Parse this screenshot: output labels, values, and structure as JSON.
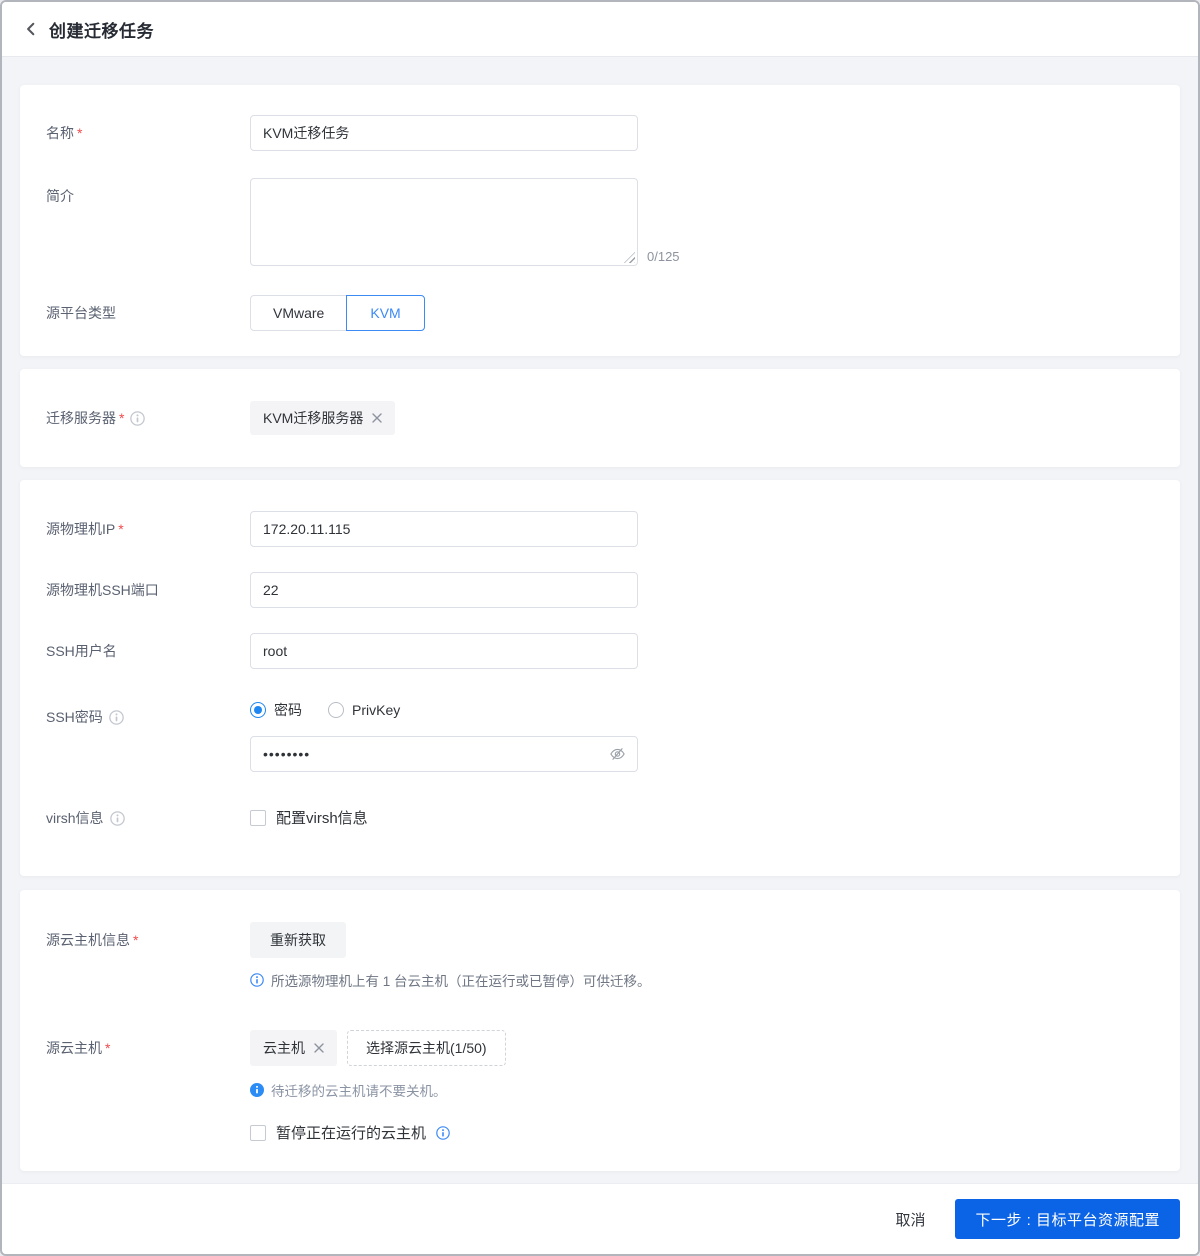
{
  "header": {
    "title": "创建迁移任务"
  },
  "misc": {
    "required_mark": "*"
  },
  "form": {
    "name": {
      "label": "名称",
      "value": "KVM迁移任务"
    },
    "intro": {
      "label": "简介",
      "value": "",
      "counter": "0/125"
    },
    "platform": {
      "label": "源平台类型",
      "options": [
        "VMware",
        "KVM"
      ],
      "selected": "KVM"
    },
    "server": {
      "label": "迁移服务器",
      "tag": "KVM迁移服务器"
    },
    "source_ip": {
      "label": "源物理机IP",
      "value": "172.20.11.115"
    },
    "ssh_port": {
      "label": "源物理机SSH端口",
      "value": "22"
    },
    "ssh_user": {
      "label": "SSH用户名",
      "value": "root"
    },
    "ssh_password": {
      "label": "SSH密码",
      "options": [
        "密码",
        "PrivKey"
      ],
      "selected": "密码",
      "value": "••••••••"
    },
    "virsh": {
      "label": "virsh信息",
      "checkbox_label": "配置virsh信息",
      "checked": false
    },
    "source_vm_info": {
      "label": "源云主机信息",
      "refresh_button": "重新获取",
      "hint": "所选源物理机上有 1 台云主机（正在运行或已暂停）可供迁移。"
    },
    "source_vm": {
      "label": "源云主机",
      "tag": "云主机",
      "select_button": "选择源云主机(1/50)",
      "hint": "待迁移的云主机请不要关机。",
      "pause_checkbox_label": "暂停正在运行的云主机",
      "pause_checked": false
    }
  },
  "footer": {
    "cancel": "取消",
    "next": "下一步 : 目标平台资源配置"
  },
  "colors": {
    "accent_blue": "#3d8af5",
    "primary_button": "#0b63e5",
    "required_red": "#f24a4d",
    "page_background": "#f2f4f8"
  }
}
